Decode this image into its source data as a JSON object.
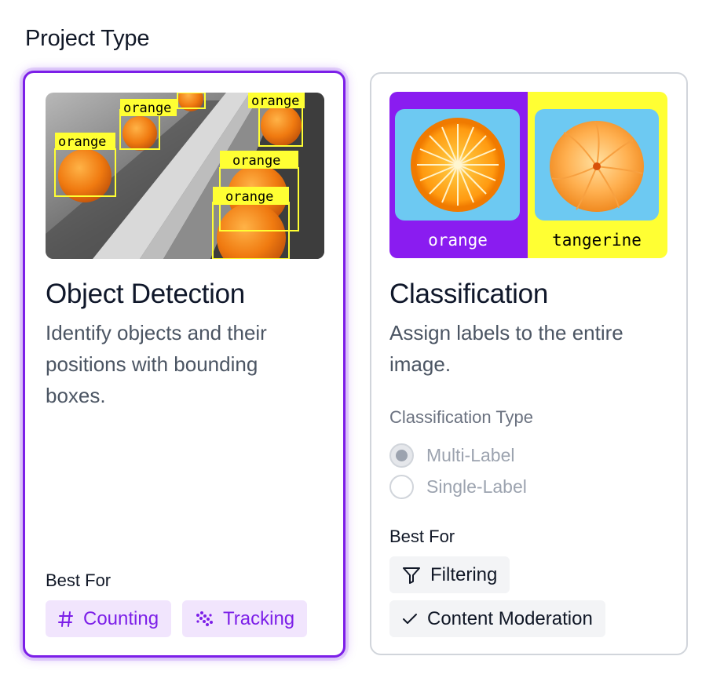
{
  "section_title": "Project Type",
  "cards": {
    "object_detection": {
      "title": "Object Detection",
      "description": "Identify objects and their positions with bounding boxes.",
      "image_labels": [
        "orange",
        "orange",
        "orange",
        "orange",
        "orange"
      ],
      "best_for_label": "Best For",
      "chips": [
        {
          "label": "Counting",
          "icon": "hash-icon"
        },
        {
          "label": "Tracking",
          "icon": "tracking-dots-icon"
        }
      ],
      "selected": true
    },
    "classification": {
      "title": "Classification",
      "description": "Assign labels to the entire image.",
      "image_labels": [
        "orange",
        "tangerine"
      ],
      "classification_type_label": "Classification Type",
      "options": [
        {
          "label": "Multi-Label",
          "checked": true
        },
        {
          "label": "Single-Label",
          "checked": false
        }
      ],
      "best_for_label": "Best For",
      "chips": [
        {
          "label": "Filtering",
          "icon": "filter-icon"
        },
        {
          "label": "Content Moderation",
          "icon": "check-icon"
        }
      ],
      "selected": false
    }
  },
  "colors": {
    "accent": "#7c1fe8",
    "chip_purple_bg": "#f1e5fd",
    "label_yellow": "#ffff33",
    "classification_left_bg": "#8a1cf0",
    "tile_blue": "#6dc9f2"
  }
}
